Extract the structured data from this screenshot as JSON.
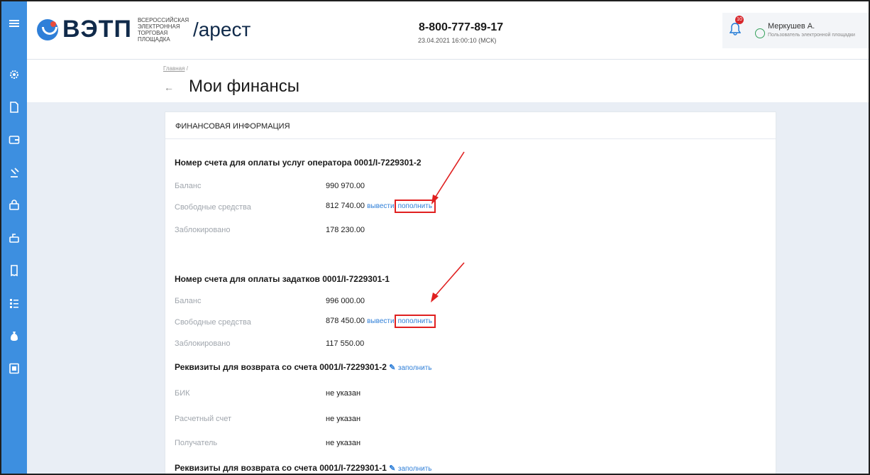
{
  "header": {
    "logo_text": "ВЭТП",
    "logo_sub": "Всероссийская электронная торговая площадка",
    "section": "/арест",
    "phone": "8-800-777-89-17",
    "datetime": "23.04.2021 16:00:10 (МСК)",
    "notifications_count": "10",
    "user_name": "Меркушев А.",
    "user_role": "Пользователь электронной площадки"
  },
  "breadcrumb": {
    "home": "Главная",
    "sep": "/"
  },
  "page_title": "Мои финансы",
  "card_title": "ФИНАНСОВАЯ ИНФОРМАЦИЯ",
  "account1": {
    "title": "Номер счета для оплаты услуг оператора 0001/I-7229301-2",
    "balance_label": "Баланс",
    "balance": "990 970.00",
    "free_label": "Свободные средства",
    "free": "812 740.00",
    "withdraw": "вывести",
    "topup": "пополнить",
    "blocked_label": "Заблокировано",
    "blocked": "178 230.00"
  },
  "account2": {
    "title": "Номер счета для оплаты задатков 0001/I-7229301-1",
    "balance_label": "Баланс",
    "balance": "996 000.00",
    "free_label": "Свободные средства",
    "free": "878 450.00",
    "withdraw": "вывести",
    "topup": "пополнить",
    "blocked_label": "Заблокировано",
    "blocked": "117 550.00"
  },
  "refund1": {
    "title": "Реквизиты для возврата со счета 0001/I-7229301-2",
    "fill": "заполнить",
    "bik_label": "БИК",
    "bik": "не указан",
    "acc_label": "Расчетный счет",
    "acc": "не указан",
    "recipient_label": "Получатель",
    "recipient": "не указан"
  },
  "refund2": {
    "title": "Реквизиты для возврата со счета 0001/I-7229301-1",
    "fill": "заполнить"
  },
  "colors": {
    "sidebar": "#3d8fe0",
    "accent": "#2f7fd8",
    "highlight": "#e02020"
  }
}
